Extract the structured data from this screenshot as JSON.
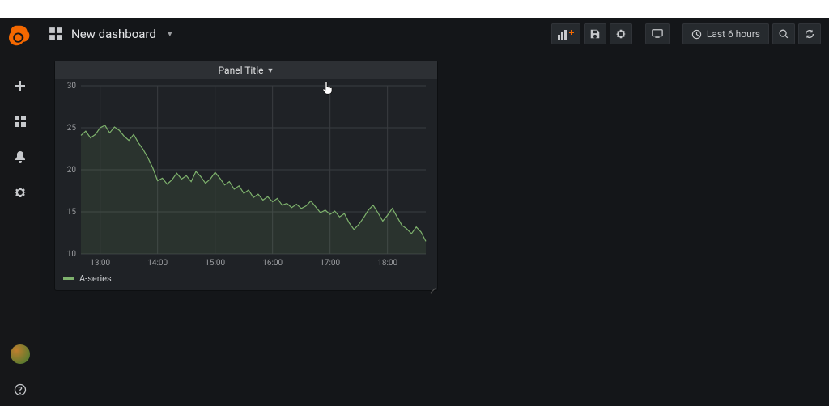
{
  "header": {
    "title": "New dashboard",
    "time_label": "Last 6 hours"
  },
  "panel": {
    "title": "Panel Title",
    "legend": [
      "A-series"
    ]
  },
  "chart_data": {
    "type": "line",
    "title": "Panel Title",
    "xlabel": "",
    "ylabel": "",
    "ylim": [
      10,
      30
    ],
    "xlim": [
      "13:00",
      "18:00"
    ],
    "x_ticks": [
      "13:00",
      "14:00",
      "15:00",
      "16:00",
      "17:00",
      "18:00"
    ],
    "y_ticks": [
      10,
      15,
      20,
      25,
      30
    ],
    "series": [
      {
        "name": "A-series",
        "color": "#7eb26d",
        "x": [
          "12:40",
          "12:45",
          "12:50",
          "12:55",
          "13:00",
          "13:05",
          "13:10",
          "13:15",
          "13:20",
          "13:25",
          "13:30",
          "13:35",
          "13:40",
          "13:45",
          "13:50",
          "13:55",
          "14:00",
          "14:05",
          "14:10",
          "14:15",
          "14:20",
          "14:25",
          "14:30",
          "14:35",
          "14:40",
          "14:45",
          "14:50",
          "14:55",
          "15:00",
          "15:05",
          "15:10",
          "15:15",
          "15:20",
          "15:25",
          "15:30",
          "15:35",
          "15:40",
          "15:45",
          "15:50",
          "15:55",
          "16:00",
          "16:05",
          "16:10",
          "16:15",
          "16:20",
          "16:25",
          "16:30",
          "16:35",
          "16:40",
          "16:45",
          "16:50",
          "16:55",
          "17:00",
          "17:05",
          "17:10",
          "17:15",
          "17:20",
          "17:25",
          "17:30",
          "17:35",
          "17:40",
          "17:45",
          "17:50",
          "17:55",
          "18:00",
          "18:05",
          "18:10",
          "18:15",
          "18:20",
          "18:25",
          "18:30",
          "18:35",
          "18:40"
        ],
        "values": [
          24.1,
          24.6,
          23.8,
          24.2,
          25.0,
          25.3,
          24.4,
          25.1,
          24.7,
          24.0,
          23.5,
          24.2,
          23.2,
          22.4,
          21.4,
          20.2,
          18.7,
          19.0,
          18.3,
          18.8,
          19.6,
          18.9,
          19.3,
          18.6,
          19.8,
          19.2,
          18.4,
          18.9,
          19.7,
          19.0,
          18.2,
          18.6,
          17.7,
          18.1,
          17.2,
          17.6,
          16.7,
          17.1,
          16.4,
          16.8,
          16.2,
          16.6,
          15.8,
          16.0,
          15.5,
          15.9,
          15.4,
          15.7,
          16.3,
          15.6,
          14.9,
          15.2,
          14.7,
          15.1,
          14.4,
          14.8,
          13.7,
          12.9,
          13.5,
          14.3,
          15.2,
          15.8,
          14.9,
          13.9,
          14.6,
          15.4,
          14.4,
          13.4,
          13.0,
          12.4,
          13.2,
          12.6,
          11.5
        ]
      }
    ]
  }
}
